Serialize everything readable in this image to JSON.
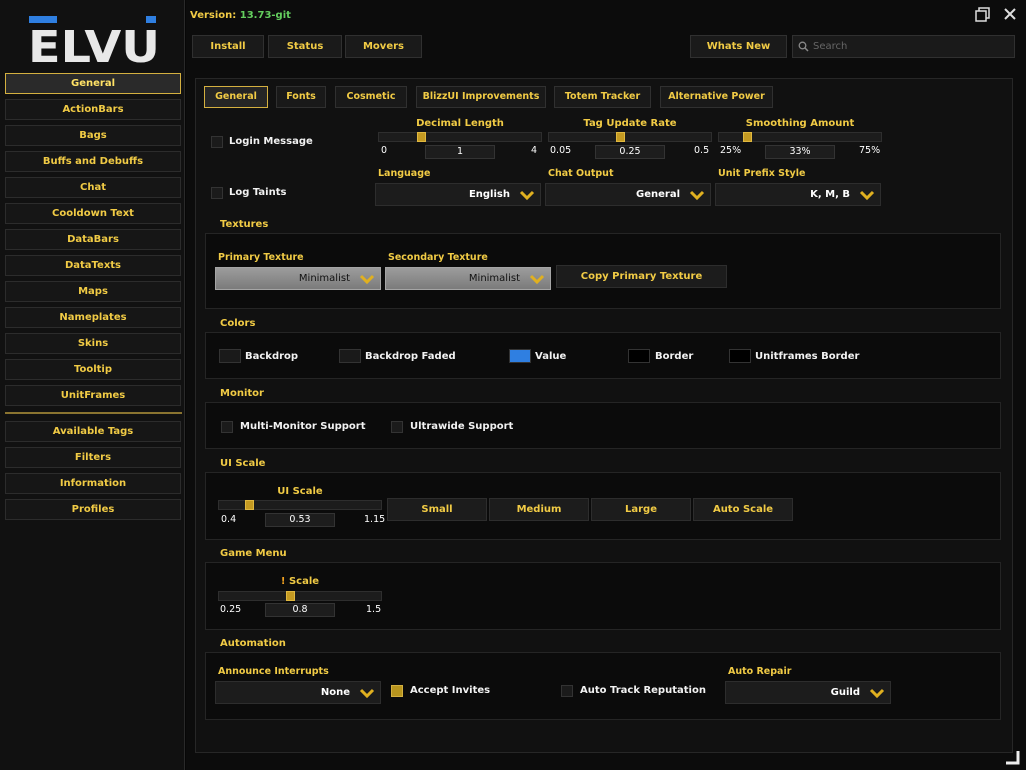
{
  "brand": {
    "logo": "ELVU",
    "accent": "#2f7fe1",
    "gold": "#f1cb45"
  },
  "version": {
    "label": "Version:",
    "number": "13.73-git"
  },
  "toolbar": {
    "install": "Install",
    "status": "Status",
    "movers": "Movers",
    "whats_new": "Whats New",
    "search_placeholder": "Search"
  },
  "window_icons": [
    "restore-icon",
    "resize-grip-icon"
  ],
  "sidebar": {
    "items": [
      "General",
      "ActionBars",
      "Bags",
      "Buffs and Debuffs",
      "Chat",
      "Cooldown Text",
      "DataBars",
      "DataTexts",
      "Maps",
      "Nameplates",
      "Skins",
      "Tooltip",
      "UnitFrames"
    ],
    "items2": [
      "Available Tags",
      "Filters",
      "Information",
      "Profiles"
    ],
    "active": "General"
  },
  "tabs": [
    "General",
    "Fonts",
    "Cosmetic",
    "BlizzUI Improvements",
    "Totem Tracker",
    "Alternative Power"
  ],
  "general": {
    "login_message": "Login Message",
    "log_taints": "Log Taints",
    "decimal_length": {
      "label": "Decimal Length",
      "min": "0",
      "max": "4",
      "value": "1",
      "fraction": 0.25
    },
    "tag_update_rate": {
      "label": "Tag Update Rate",
      "min": "0.05",
      "max": "0.5",
      "value": "0.25",
      "fraction": 0.44
    },
    "smoothing": {
      "label": "Smoothing Amount",
      "min": "25%",
      "max": "75%",
      "value": "33%",
      "fraction": 0.16
    },
    "language": {
      "label": "Language",
      "value": "English"
    },
    "chat_output": {
      "label": "Chat Output",
      "value": "General"
    },
    "unit_prefix": {
      "label": "Unit Prefix Style",
      "value": "K, M, B"
    }
  },
  "textures": {
    "title": "Textures",
    "primary_label": "Primary Texture",
    "primary": "Minimalist",
    "secondary_label": "Secondary Texture",
    "secondary": "Minimalist",
    "copy": "Copy Primary Texture"
  },
  "colors": {
    "title": "Colors",
    "items": [
      {
        "label": "Backdrop",
        "color": "#1a1a1a"
      },
      {
        "label": "Backdrop Faded",
        "color": "#1a1a1a"
      },
      {
        "label": "Value",
        "color": "#2f7fe1"
      },
      {
        "label": "Border",
        "color": "#000000"
      },
      {
        "label": "Unitframes Border",
        "color": "#000000"
      }
    ]
  },
  "monitor": {
    "title": "Monitor",
    "multi": "Multi-Monitor Support",
    "ultrawide": "Ultrawide Support"
  },
  "ui_scale": {
    "title": "UI Scale",
    "label": "UI Scale",
    "min": "0.4",
    "max": "1.15",
    "value": "0.53",
    "fraction": 0.17,
    "small": "Small",
    "medium": "Medium",
    "large": "Large",
    "auto": "Auto Scale"
  },
  "game_menu": {
    "title": "Game Menu",
    "label": "Scale",
    "min": "0.25",
    "max": "1.5",
    "value": "0.8",
    "fraction": 0.44
  },
  "automation": {
    "title": "Automation",
    "announce_label": "Announce Interrupts",
    "announce": "None",
    "accept_invites": "Accept Invites",
    "auto_track": "Auto Track Reputation",
    "repair_label": "Auto Repair",
    "repair": "Guild"
  }
}
